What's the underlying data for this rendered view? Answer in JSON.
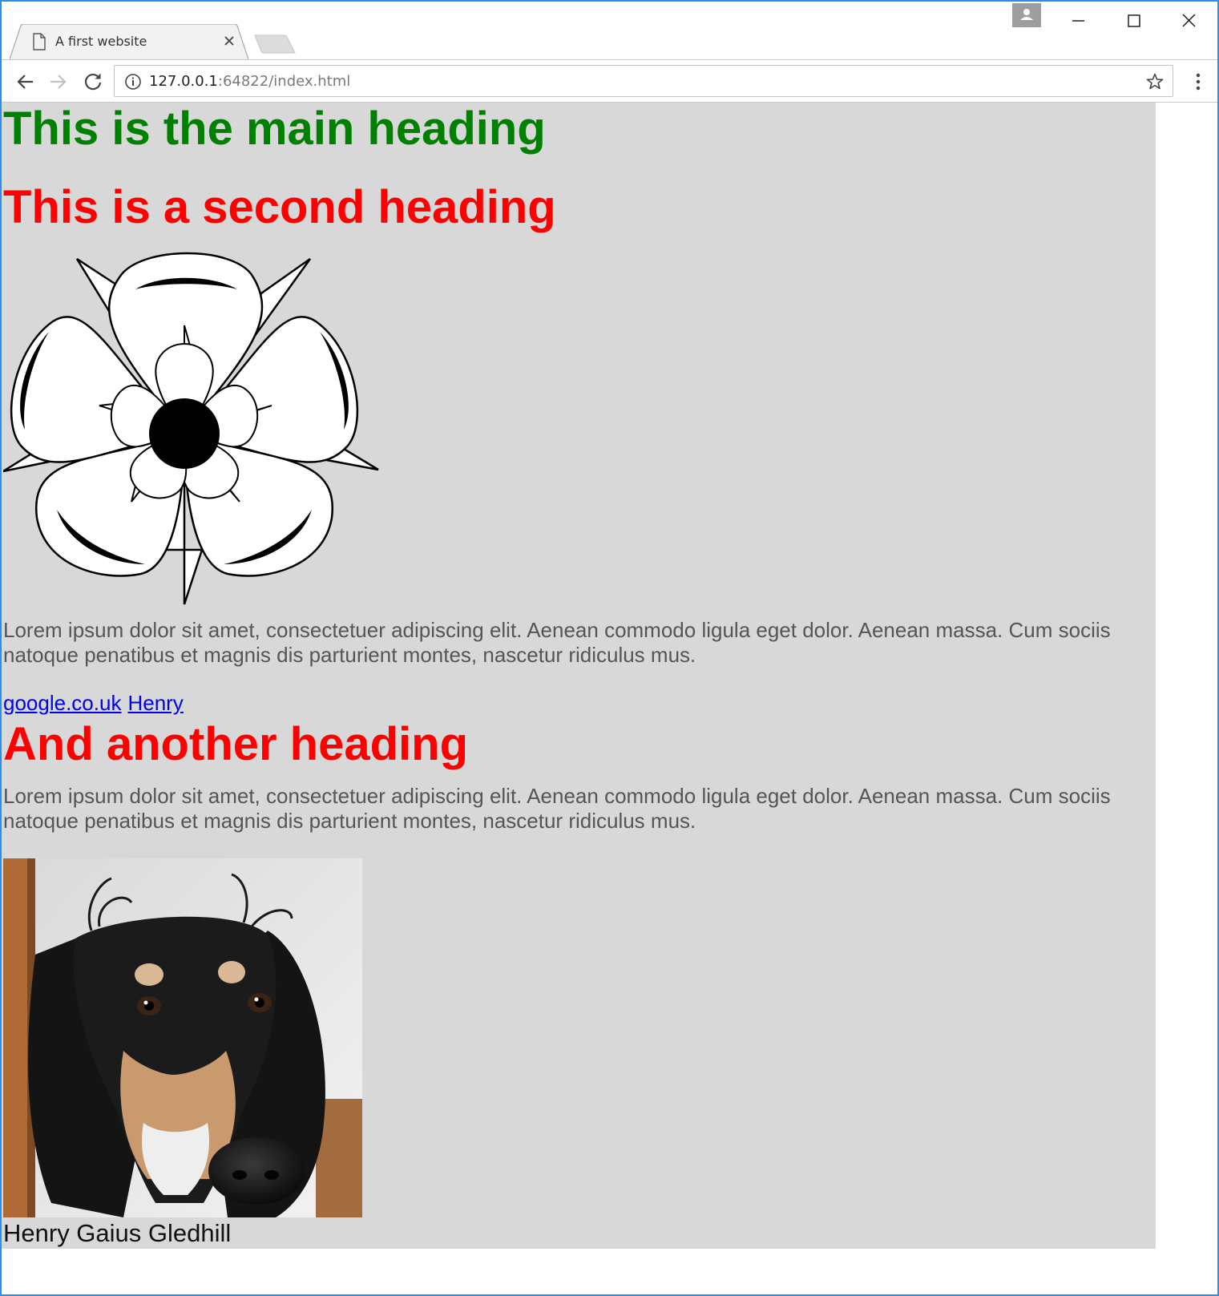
{
  "browser": {
    "tab_title": "A first website",
    "url_host": "127.0.0.1",
    "url_rest": ":64822/index.html"
  },
  "page": {
    "main_heading": "This is the main heading",
    "second_heading": "This is a second heading",
    "paragraph_1": "Lorem ipsum dolor sit amet, consectetuer adipiscing elit. Aenean commodo ligula eget dolor. Aenean massa. Cum sociis natoque penatibus et magnis dis parturient montes, nascetur ridiculus mus.",
    "links": [
      {
        "label": "google.co.uk"
      },
      {
        "label": "Henry"
      }
    ],
    "third_heading": "And another heading",
    "paragraph_2": "Lorem ipsum dolor sit amet, consectetuer adipiscing elit. Aenean commodo ligula eget dolor. Aenean massa. Cum sociis natoque penatibus et magnis dis parturient montes, nascetur ridiculus mus.",
    "caption": "Henry Gaius Gledhill"
  },
  "colors": {
    "main_heading": "#008000",
    "secondary_heading": "#ff0000",
    "page_background": "#d8d8d8",
    "link": "#0000ee",
    "window_border": "#2b8fe8"
  }
}
